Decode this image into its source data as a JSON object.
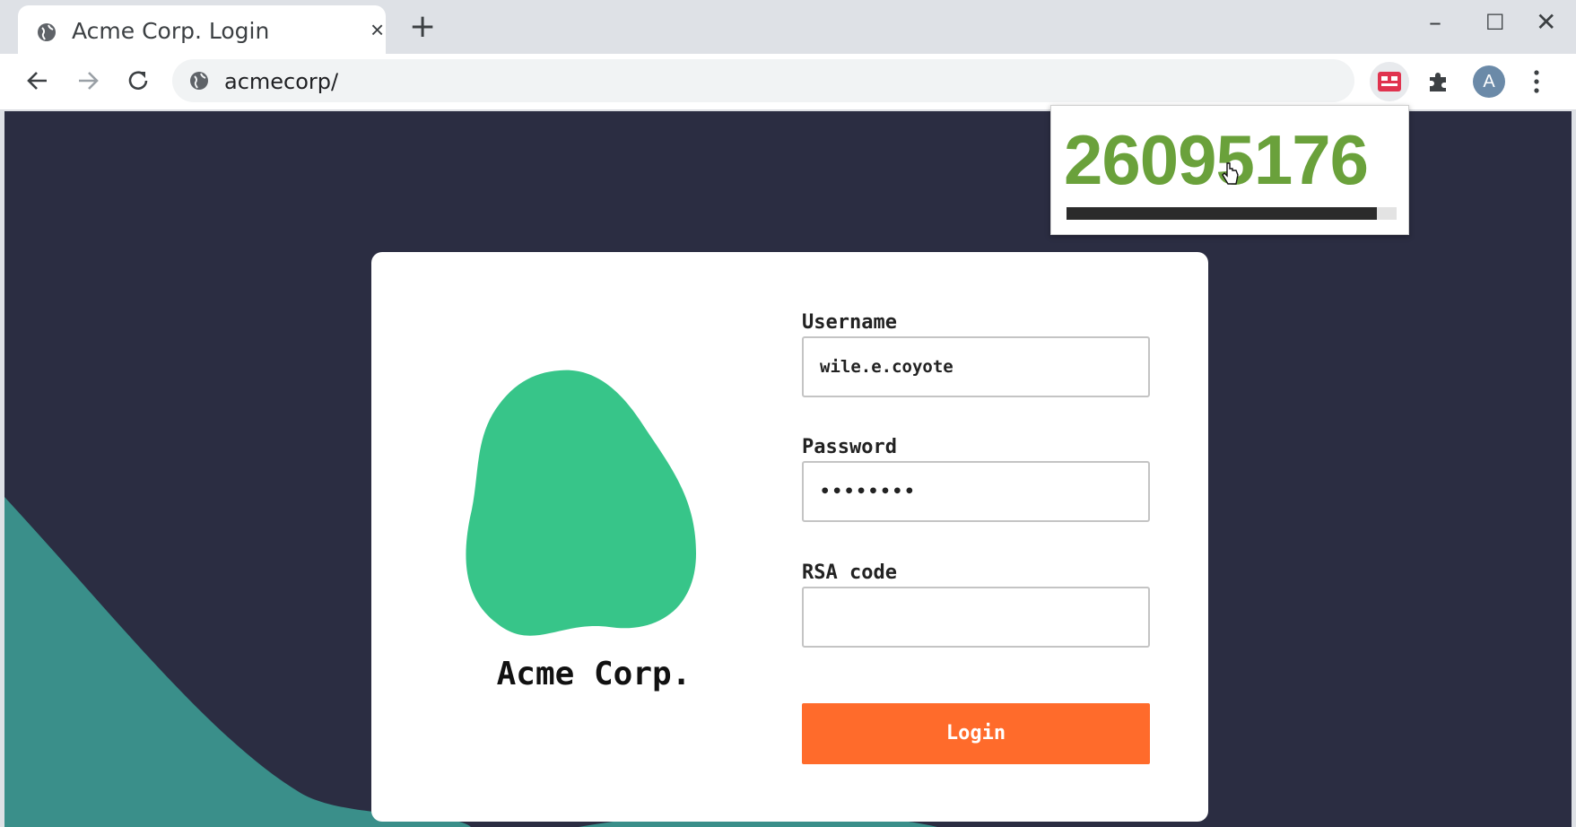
{
  "browser": {
    "tab_title": "Acme Corp. Login",
    "tab_close": "×",
    "new_tab": "+",
    "url": "acmecorp/",
    "avatar_letter": "A",
    "window_controls": {
      "minimize": "–",
      "maximize": "☐",
      "close": "✕"
    }
  },
  "login": {
    "brand": "Acme Corp.",
    "username_label": "Username",
    "username_value": "wile.e.coyote",
    "password_label": "Password",
    "password_value": "••••••••",
    "rsa_label": "RSA code",
    "rsa_value": "",
    "login_button": "Login"
  },
  "extension_popup": {
    "code": "26095176",
    "progress_fraction": 0.94
  },
  "colors": {
    "page_bg": "#2b2d42",
    "wave": "#3a8f8a",
    "blob": "#37c589",
    "login_button": "#ff6b2b",
    "otp_text": "#6aa13b",
    "extension_icon": "#e0334f"
  },
  "icons": [
    "globe-icon",
    "back-icon",
    "forward-icon",
    "reload-icon",
    "extension-authenticator-icon",
    "puzzle-icon",
    "menu-icon",
    "cursor-icon"
  ]
}
